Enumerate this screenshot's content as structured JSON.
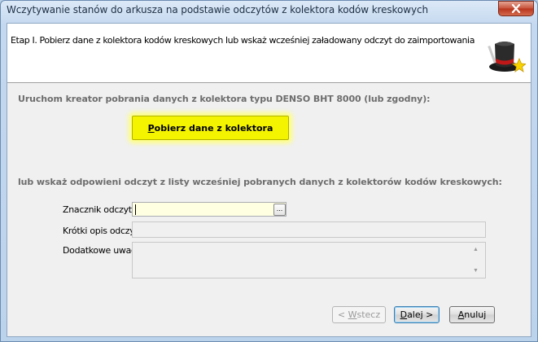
{
  "window": {
    "title": "Wczytywanie stanów do arkusza na podstawie odczytów z kolektora kodów kreskowych"
  },
  "header": {
    "step_text": "Etap I.  Pobierz dane z kolektora kodów kreskowych lub wskaż wcześniej załadowany odczyt do zaimportowania"
  },
  "section1": {
    "heading": "Uruchom kreator pobrania danych z kolektora typu DENSO BHT 8000 (lub zgodny):",
    "fetch_button_pre": "",
    "fetch_button_accel": "P",
    "fetch_button_rest": "obierz dane z kolektora"
  },
  "section2": {
    "heading": "lub wskaż odpowieni odczyt z listy wcześniej pobranych danych z kolektorów kodów kreskowych:"
  },
  "form": {
    "marker_label": "Znacznik odczytu",
    "marker_value": "",
    "ellipsis": "...",
    "short_desc_label": "Krótki opis odczytu",
    "short_desc_value": "",
    "notes_label": "Dodatkowe uwagi",
    "notes_value": ""
  },
  "buttons": {
    "back_pre": "< ",
    "back_accel": "W",
    "back_rest": "stecz",
    "next_accel": "D",
    "next_rest": "alej >",
    "cancel_accel": "A",
    "cancel_rest": "nuluj"
  },
  "colors": {
    "fetch_button": "#f4f400",
    "active_field": "#ffffe1"
  }
}
